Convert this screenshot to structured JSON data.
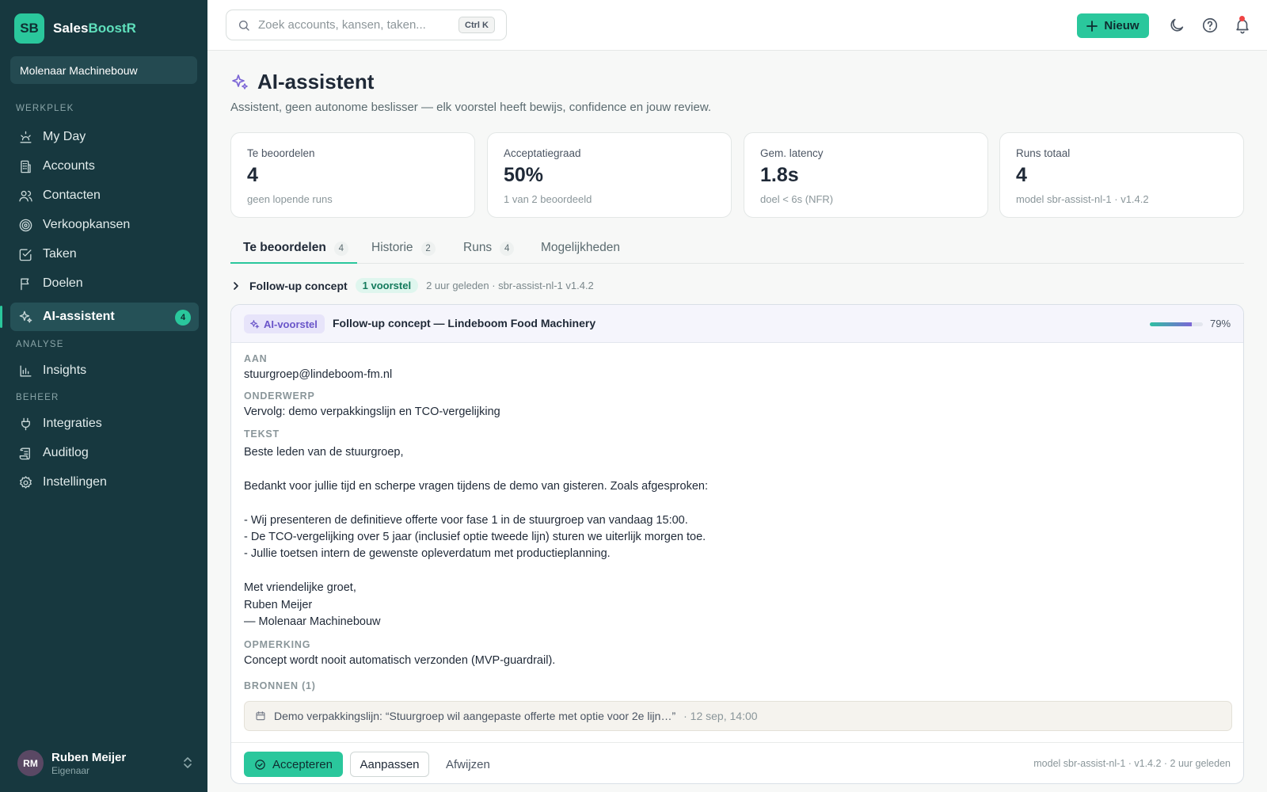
{
  "brand": {
    "logo": "SB",
    "name_main": "Sales",
    "name_accent": "BoostR"
  },
  "workspace": "Molenaar Machinebouw",
  "sidebar": {
    "sections": [
      "WERKPLEK",
      "ANALYSE",
      "BEHEER"
    ],
    "items": [
      {
        "label": "My Day",
        "icon": "my-day-icon"
      },
      {
        "label": "Accounts",
        "icon": "building-icon"
      },
      {
        "label": "Contacten",
        "icon": "users-icon"
      },
      {
        "label": "Verkoopkansen",
        "icon": "target-icon"
      },
      {
        "label": "Taken",
        "icon": "task-icon"
      },
      {
        "label": "Doelen",
        "icon": "flag-icon"
      },
      {
        "label": "AI-assistent",
        "icon": "sparkles-icon",
        "badge": "4",
        "active": true
      },
      {
        "label": "Insights",
        "icon": "bar-chart-icon"
      },
      {
        "label": "Integraties",
        "icon": "plug-icon"
      },
      {
        "label": "Auditlog",
        "icon": "scroll-icon"
      },
      {
        "label": "Instellingen",
        "icon": "gear-icon"
      }
    ]
  },
  "user": {
    "initials": "RM",
    "name": "Ruben Meijer",
    "role": "Eigenaar"
  },
  "topbar": {
    "search_placeholder": "Zoek accounts, kansen, taken...",
    "shortcut": "Ctrl K",
    "new_label": "Nieuw"
  },
  "page": {
    "title": "AI-assistent",
    "subtitle": "Assistent, geen autonome beslisser — elk voorstel heeft bewijs, confidence en jouw review."
  },
  "kpis": [
    {
      "label": "Te beoordelen",
      "value": "4",
      "note": "geen lopende runs"
    },
    {
      "label": "Acceptatiegraad",
      "value": "50%",
      "note": "1 van 2 beoordeeld"
    },
    {
      "label": "Gem. latency",
      "value": "1.8s",
      "note": "doel < 6s (NFR)"
    },
    {
      "label": "Runs totaal",
      "value": "4",
      "note": "model sbr-assist-nl-1 · v1.4.2"
    }
  ],
  "tabs": [
    {
      "label": "Te beoordelen",
      "count": "4",
      "active": true
    },
    {
      "label": "Historie",
      "count": "2"
    },
    {
      "label": "Runs",
      "count": "4"
    },
    {
      "label": "Mogelijkheden",
      "count": ""
    }
  ],
  "group": {
    "title": "Follow-up concept",
    "pill": "1 voorstel",
    "meta": "2 uur geleden · sbr-assist-nl-1 v1.4.2"
  },
  "card": {
    "badge": "AI-voorstel",
    "title": "Follow-up concept — Lindeboom Food Machinery",
    "confidence": 0.79,
    "confidence_label": "79%",
    "to_label": "AAN",
    "to_value": "stuurgroep@lindeboom-fm.nl",
    "subject_label": "ONDERWERP",
    "subject_value": "Vervolg: demo verpakkingslijn en TCO-vergelijking",
    "text_label": "TEKST",
    "text_value": "Beste leden van de stuurgroep,\n\nBedankt voor jullie tijd en scherpe vragen tijdens de demo van gisteren. Zoals afgesproken:\n\n- Wij presenteren de definitieve offerte voor fase 1 in de stuurgroep van vandaag 15:00.\n- De TCO-vergelijking over 5 jaar (inclusief optie tweede lijn) sturen we uiterlijk morgen toe.\n- Jullie toetsen intern de gewenste opleverdatum met productieplanning.\n\nMet vriendelijke groet,\nRuben Meijer\n— Molenaar Machinebouw",
    "remark_label": "OPMERKING",
    "remark_value": "Concept wordt nooit automatisch verzonden (MVP-guardrail).",
    "sources_label": "BRONNEN (1)",
    "source_text": "Demo verpakkingslijn: “Stuurgroep wil aangepaste offerte met optie voor 2e lijn…”",
    "source_date": "· 12 sep, 14:00",
    "accept_label": "Accepteren",
    "adjust_label": "Aanpassen",
    "reject_label": "Afwijzen",
    "footer_meta": "model sbr-assist-nl-1 · v1.4.2 · 2 uur geleden"
  }
}
